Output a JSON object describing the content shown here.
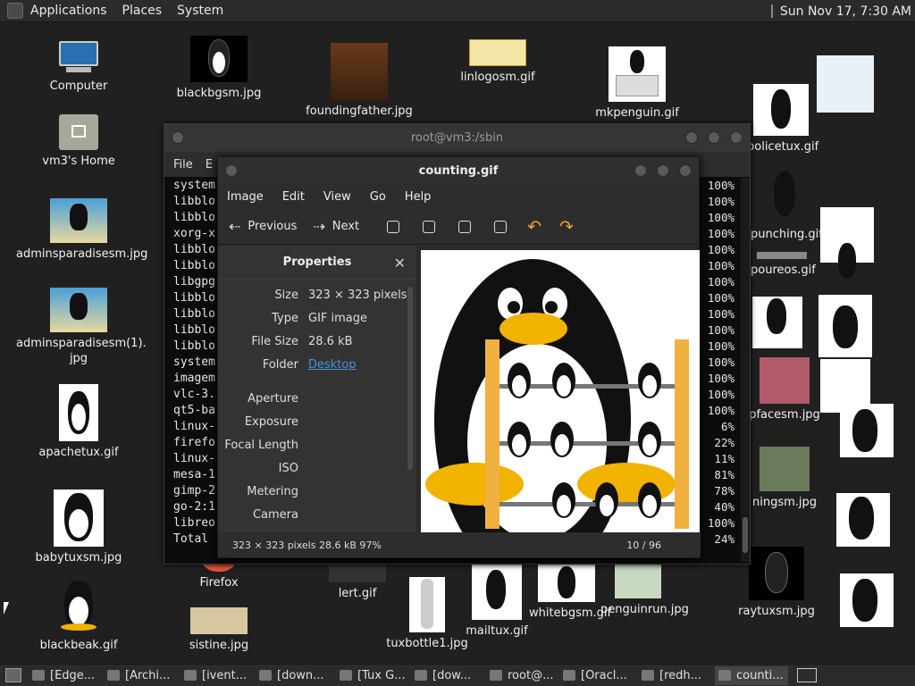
{
  "top_panel": {
    "menus": [
      "Applications",
      "Places",
      "System"
    ],
    "clock": "Sun Nov 17,  7:30 AM"
  },
  "desktop_icons": {
    "computer": "Computer",
    "home": "vm3's Home",
    "adminsparadise": "adminsparadisesm.jpg",
    "adminsparadise1": "adminsparadisesm(1).\njpg",
    "apachetux": "apachetux.gif",
    "babytux": "babytuxsm.jpg",
    "blackbeak": "blackbeak.gif",
    "blackbg": "blackbgsm.jpg",
    "foundingfather": "foundingfather.jpg",
    "linlogo": "linlogosm.gif",
    "mkpenguin": "mkpenguin.gif",
    "firefox": "Firefox",
    "sistine": "sistine.jpg",
    "lert": "lert.gif",
    "tuxbottle": "tuxbottle1.jpg",
    "mailtux": "mailtux.gif",
    "whitebg": "whitebgsm.gif",
    "penguinrun": "penguinrun.jpg",
    "raytux": "raytuxsm.jpg",
    "policetux": "policetux.gif",
    "punching": "punching.gif",
    "pureos": "poureos.gif",
    "pfacesm": "pfacesm.jpg",
    "ningsm": "ningsm.jpg"
  },
  "terminal": {
    "title": "root@vm3:/sbin",
    "menu": [
      "File",
      "E"
    ],
    "lines": [
      "system",
      "libblo",
      "libblo",
      "xorg-x",
      "libblo",
      "libblo",
      "libgpg",
      "libblo",
      "libblo",
      "libblo",
      "libblo",
      "system",
      "imagem",
      "vlc-3.",
      "qt5-ba",
      "linux-",
      "firefo",
      "linux-",
      "mesa-1",
      "gimp-2",
      "go-2:1",
      "libreo",
      "Total"
    ],
    "percents": [
      "100%",
      "100%",
      "100%",
      "100%",
      "100%",
      "100%",
      "100%",
      "100%",
      "100%",
      "100%",
      "100%",
      "100%",
      "100%",
      "100%",
      "100%",
      "6%",
      "22%",
      "11%",
      "81%",
      "78%",
      "40%",
      "100%",
      "24%"
    ]
  },
  "viewer": {
    "title": "counting.gif",
    "menu": [
      "Image",
      "Edit",
      "View",
      "Go",
      "Help"
    ],
    "toolbar": {
      "previous": "Previous",
      "next": "Next"
    },
    "properties": {
      "header": "Properties",
      "rows": [
        {
          "key": "Size",
          "value": "323 × 323 pixels"
        },
        {
          "key": "Type",
          "value": "GIF image"
        },
        {
          "key": "File Size",
          "value": "28.6 kB"
        },
        {
          "key": "Folder",
          "value": "Desktop"
        },
        {
          "key": "Aperture",
          "value": ""
        },
        {
          "key": "Exposure",
          "value": ""
        },
        {
          "key": "Focal Length",
          "value": ""
        },
        {
          "key": "ISO",
          "value": ""
        },
        {
          "key": "Metering",
          "value": ""
        },
        {
          "key": "Camera",
          "value": ""
        }
      ]
    },
    "status": {
      "info": "323 × 323 pixels  28.6 kB    97%",
      "position": "10 / 96"
    }
  },
  "taskbar": {
    "tasks": [
      "[Edge...",
      "[Archi...",
      "[ivent...",
      "[down...",
      "[Tux G...",
      "[dow...",
      "root@...",
      "[Oracl...",
      "[redh...",
      "counti..."
    ]
  }
}
